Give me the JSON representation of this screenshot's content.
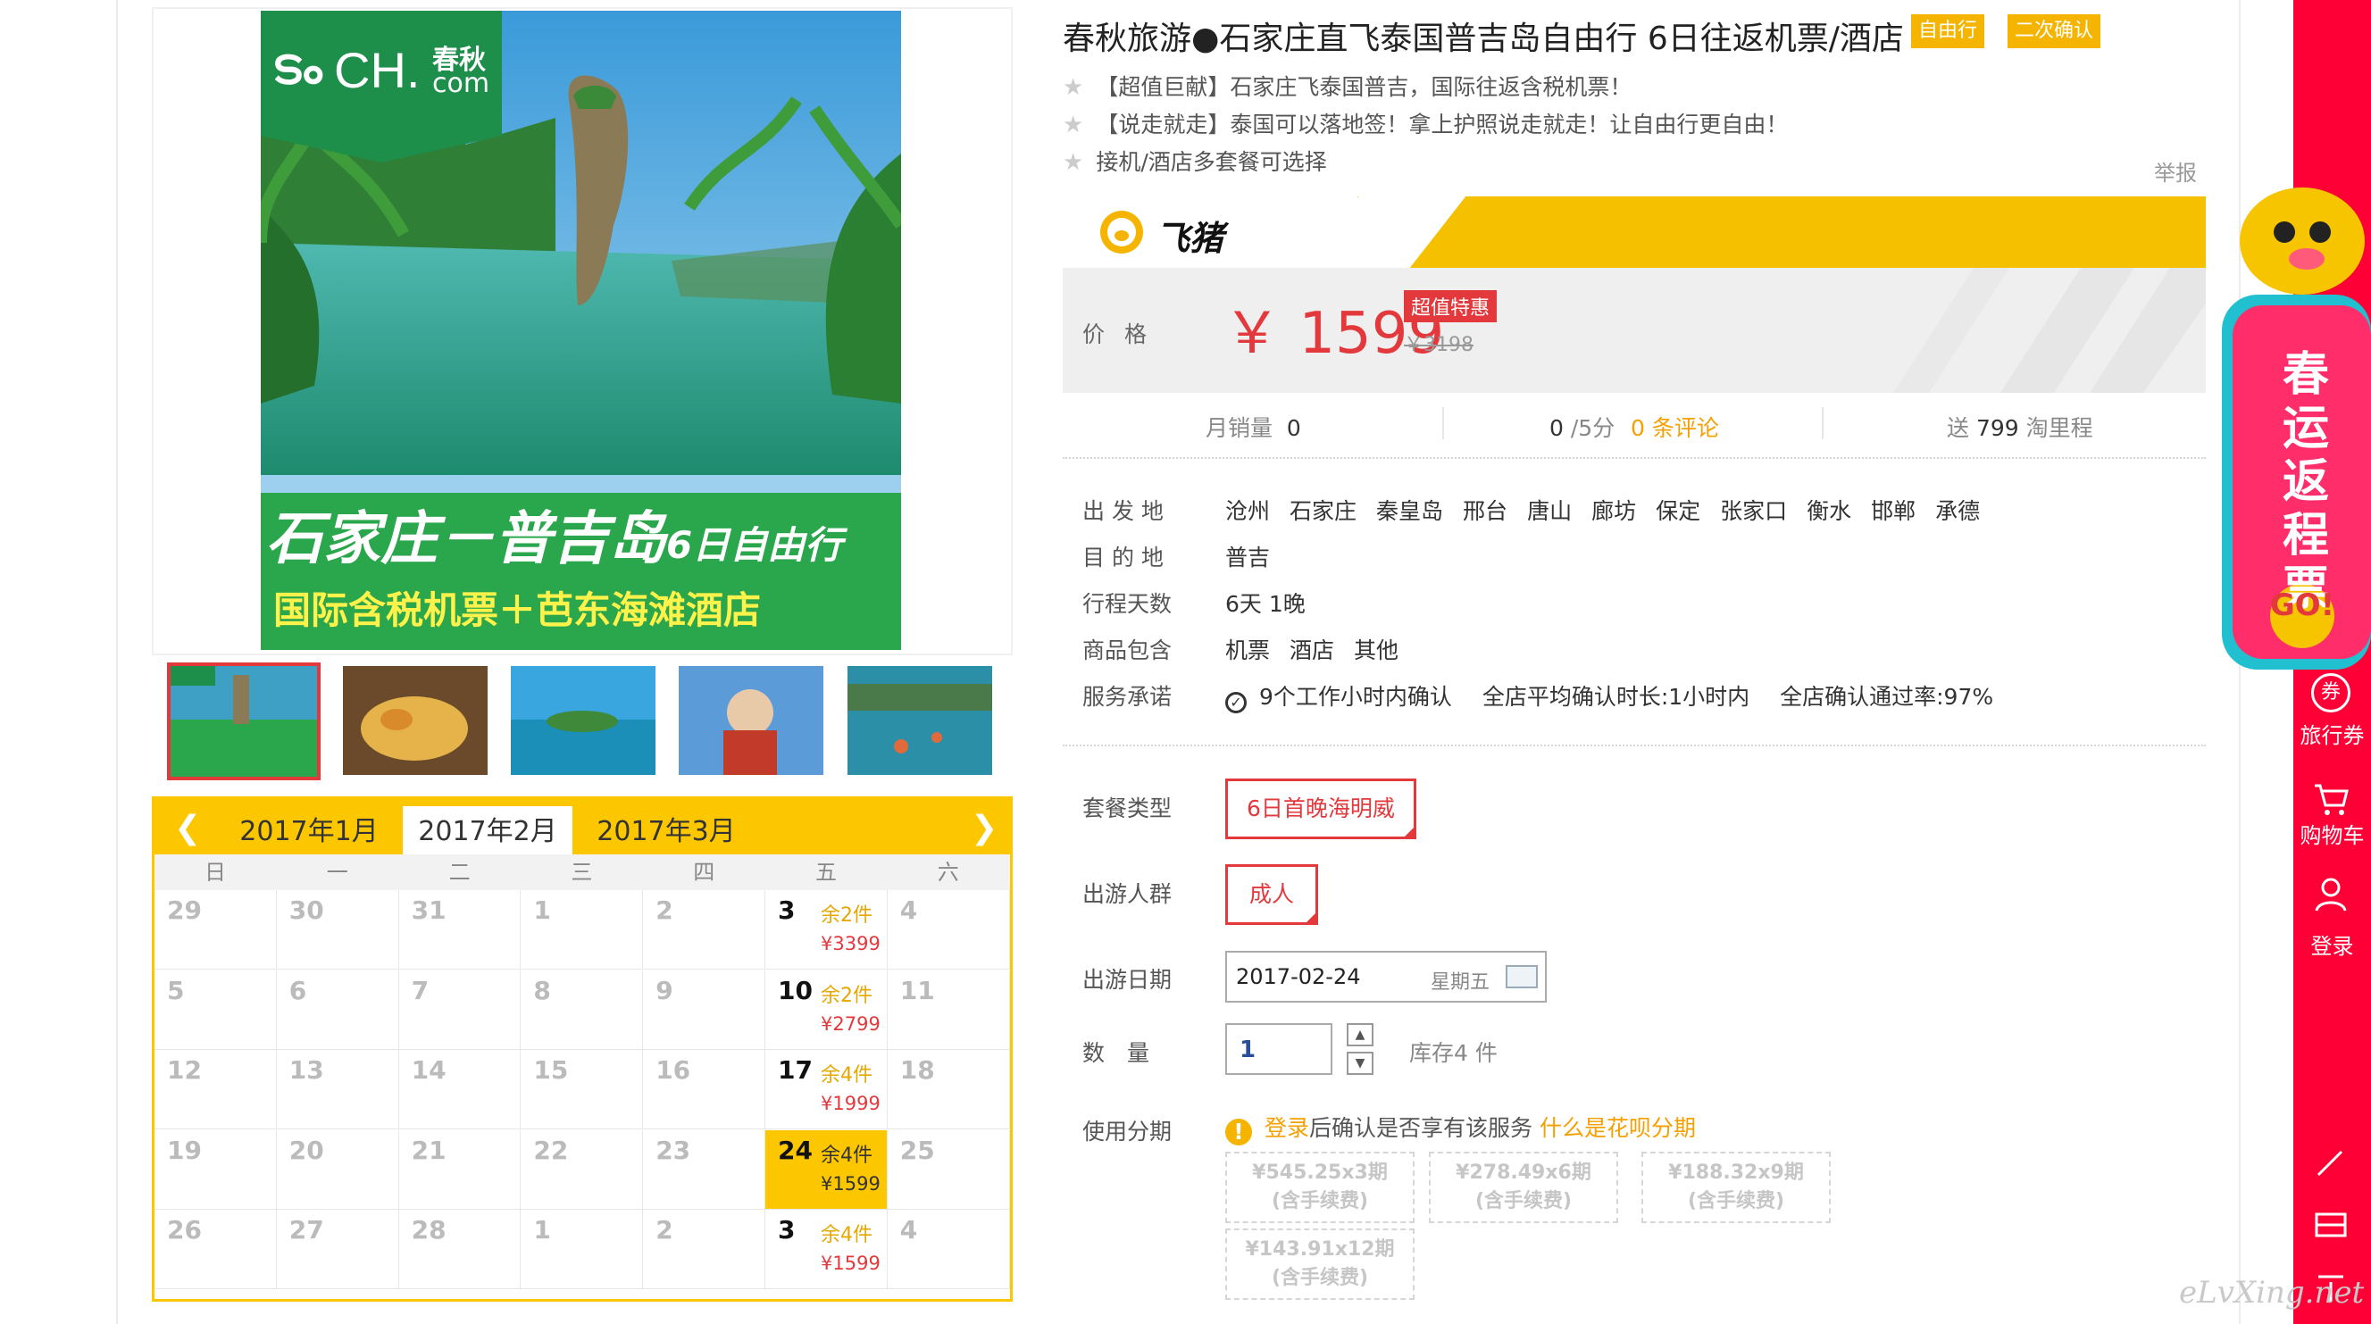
{
  "brand": {
    "logo_text": "CH.",
    "logo_cn": "春秋",
    "logo_com": "com"
  },
  "banner": {
    "headline": "石家庄－普吉岛",
    "days": "6日自由行",
    "subline": "国际含税机票＋芭东海滩酒店"
  },
  "product": {
    "title": "春秋旅游●石家庄直飞泰国普吉岛自由行 6日往返机票/酒店",
    "tags": [
      "自由行",
      "二次确认"
    ],
    "bullets": [
      "【超值巨献】石家庄飞泰国普吉，国际往返含税机票！",
      "【说走就走】泰国可以落地签！拿上护照说走就走！让自由行更自由！",
      "接机/酒店多套餐可选择"
    ],
    "report": "举报"
  },
  "fliggy": {
    "logo": "飞猪"
  },
  "price": {
    "label": "价格",
    "value": "￥ 1599",
    "badge": "超值特惠",
    "original": "￥3198"
  },
  "stats": {
    "monthly_label": "月销量",
    "monthly_value": "0",
    "score_value": "0",
    "score_unit": "/5分",
    "reviews": "0 条评论",
    "miles_prefix": "送",
    "miles_value": "799",
    "miles_suffix": "淘里程"
  },
  "details": {
    "depart_label": "出 发 地",
    "depart_cities": [
      "沧州",
      "石家庄",
      "秦皇岛",
      "邢台",
      "唐山",
      "廊坊",
      "保定",
      "张家口",
      "衡水",
      "邯郸",
      "承德"
    ],
    "dest_label": "目 的 地",
    "dest_value": "普吉",
    "days_label": "行程天数",
    "days_value": "6天 1晚",
    "includes_label": "商品包含",
    "includes": [
      "机票",
      "酒店",
      "其他"
    ],
    "service_label": "服务承诺",
    "service": [
      "9个工作小时内确认",
      "全店平均确认时长:1小时内",
      "全店确认通过率:97%"
    ]
  },
  "options": {
    "package_label": "套餐类型",
    "package_value": "6日首晚海明威",
    "crowd_label": "出游人群",
    "crowd_value": "成人",
    "date_label": "出游日期",
    "date_value": "2017-02-24",
    "date_weekday": "星期五",
    "qty_label": "数　量",
    "qty_value": "1",
    "stock": "库存4 件",
    "installment_label": "使用分期",
    "installment_login": "登录",
    "installment_text": "后确认是否享有该服务",
    "installment_link": "什么是花呗分期",
    "installments": [
      {
        "amount": "¥545.25x3期",
        "fee": "(含手续费)"
      },
      {
        "amount": "¥278.49x6期",
        "fee": "(含手续费)"
      },
      {
        "amount": "¥188.32x9期",
        "fee": "(含手续费)"
      },
      {
        "amount": "¥143.91x12期",
        "fee": "(含手续费)"
      }
    ]
  },
  "calendar": {
    "months": [
      "2017年1月",
      "2017年2月",
      "2017年3月"
    ],
    "active_month": 1,
    "weekdays": [
      "日",
      "一",
      "二",
      "三",
      "四",
      "五",
      "六"
    ],
    "weeks": [
      [
        {
          "d": "29"
        },
        {
          "d": "30"
        },
        {
          "d": "31"
        },
        {
          "d": "1"
        },
        {
          "d": "2"
        },
        {
          "d": "3",
          "rest": "余2件",
          "price": "¥3399"
        },
        {
          "d": "4"
        }
      ],
      [
        {
          "d": "5"
        },
        {
          "d": "6"
        },
        {
          "d": "7"
        },
        {
          "d": "8"
        },
        {
          "d": "9"
        },
        {
          "d": "10",
          "rest": "余2件",
          "price": "¥2799"
        },
        {
          "d": "11"
        }
      ],
      [
        {
          "d": "12"
        },
        {
          "d": "13"
        },
        {
          "d": "14"
        },
        {
          "d": "15"
        },
        {
          "d": "16"
        },
        {
          "d": "17",
          "rest": "余4件",
          "price": "¥1999"
        },
        {
          "d": "18"
        }
      ],
      [
        {
          "d": "19"
        },
        {
          "d": "20"
        },
        {
          "d": "21"
        },
        {
          "d": "22"
        },
        {
          "d": "23"
        },
        {
          "d": "24",
          "rest": "余4件",
          "price": "¥1599",
          "selected": true
        },
        {
          "d": "25"
        }
      ],
      [
        {
          "d": "26"
        },
        {
          "d": "27"
        },
        {
          "d": "28"
        },
        {
          "d": "1"
        },
        {
          "d": "2"
        },
        {
          "d": "3",
          "rest": "余4件",
          "price": "¥1599"
        },
        {
          "d": "4"
        }
      ]
    ]
  },
  "sidebar": {
    "promo": [
      "春",
      "运",
      "返",
      "程",
      "票"
    ],
    "promo_go": "GO!",
    "coupon_icon_text": "券",
    "coupon": "旅行券",
    "cart": "购物车",
    "login": "登录"
  },
  "watermark": "eLvXing.net",
  "colors": {
    "accent": "#e4393c",
    "yellow": "#fdc700",
    "sidebar": "#ff0036"
  }
}
